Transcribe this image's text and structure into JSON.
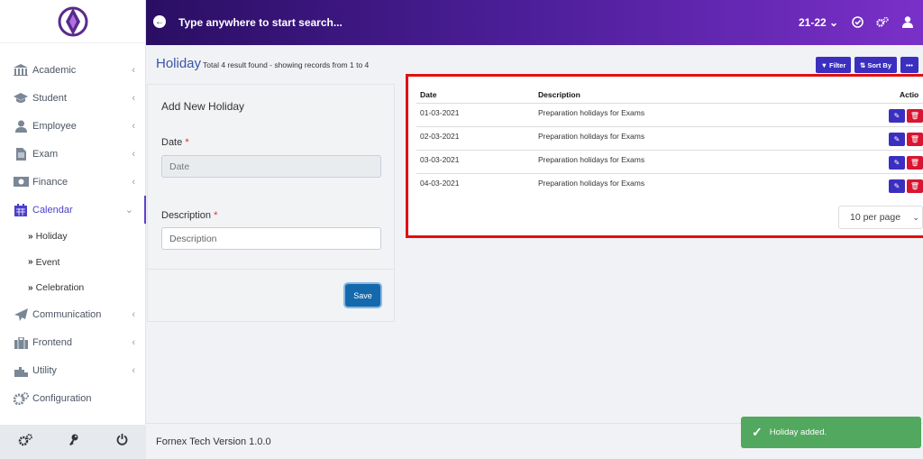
{
  "topbar": {
    "search_placeholder": "Type anywhere to start search...",
    "session": "21-22"
  },
  "sidebar": {
    "items": [
      {
        "label": "Academic",
        "icon": "academic-icon"
      },
      {
        "label": "Student",
        "icon": "student-icon"
      },
      {
        "label": "Employee",
        "icon": "employee-icon"
      },
      {
        "label": "Exam",
        "icon": "exam-icon"
      },
      {
        "label": "Finance",
        "icon": "finance-icon"
      },
      {
        "label": "Calendar",
        "icon": "calendar-icon",
        "active": true
      }
    ],
    "subitems": [
      "Holiday",
      "Event",
      "Celebration"
    ],
    "items_after": [
      {
        "label": "Communication",
        "icon": "communication-icon"
      },
      {
        "label": "Frontend",
        "icon": "frontend-icon"
      },
      {
        "label": "Utility",
        "icon": "utility-icon"
      },
      {
        "label": "Configuration",
        "icon": "configuration-icon"
      }
    ]
  },
  "header": {
    "title": "Holiday",
    "subtitle": "Total 4 result found - showing records from 1 to 4",
    "filter_label": "Filter",
    "sortby_label": "Sort By",
    "more_label": "•••"
  },
  "form": {
    "title": "Add New Holiday",
    "date_label": "Date",
    "date_placeholder": "Date",
    "description_label": "Description",
    "description_placeholder": "Description",
    "save_label": "Save"
  },
  "table": {
    "headers": [
      "Date",
      "Description",
      "Actio"
    ],
    "rows": [
      {
        "date": "01-03-2021",
        "description": "Preparation holidays for Exams"
      },
      {
        "date": "02-03-2021",
        "description": "Preparation holidays for Exams"
      },
      {
        "date": "03-03-2021",
        "description": "Preparation holidays for Exams"
      },
      {
        "date": "04-03-2021",
        "description": "Preparation holidays for Exams"
      }
    ],
    "per_page": "10 per page"
  },
  "footer": {
    "version": "Fornex Tech Version 1.0.0"
  },
  "toast": {
    "message": "Holiday added."
  },
  "colors": {
    "accent": "#3b2fc0",
    "danger": "#d91531",
    "success": "#52a85e",
    "highlight": "#e01010"
  }
}
